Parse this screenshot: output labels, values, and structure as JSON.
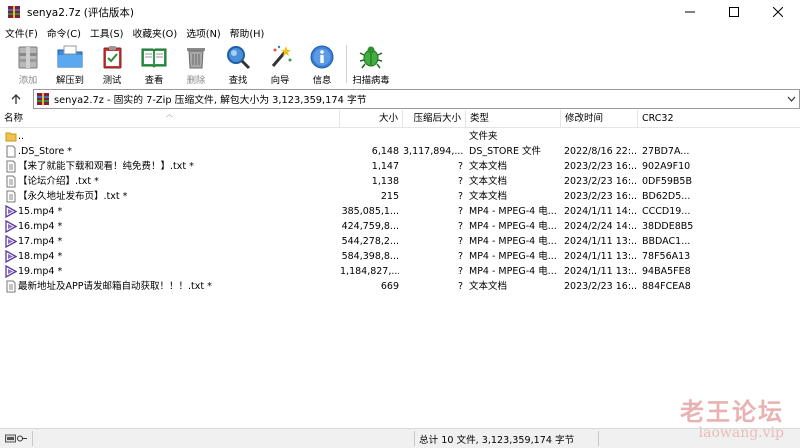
{
  "window": {
    "title": "senya2.7z (评估版本)"
  },
  "menu": [
    "文件(F)",
    "命令(C)",
    "工具(S)",
    "收藏夹(O)",
    "选项(N)",
    "帮助(H)"
  ],
  "toolbar": {
    "add": "添加",
    "extract": "解压到",
    "test": "测试",
    "view": "查看",
    "delete": "删除",
    "find": "查找",
    "wizard": "向导",
    "info": "信息",
    "scan": "扫描病毒"
  },
  "address": {
    "text": "senya2.7z - 固实的 7-Zip 压缩文件, 解包大小为 3,123,359,174 字节"
  },
  "columns": {
    "name": "名称",
    "size": "大小",
    "packed": "压缩后大小",
    "type": "类型",
    "modified": "修改时间",
    "crc": "CRC32"
  },
  "files": [
    {
      "icon": "folder-up-icon",
      "name": "..",
      "size": "",
      "packed": "",
      "type": "文件夹",
      "modified": "",
      "crc": ""
    },
    {
      "icon": "file-icon",
      "name": ".DS_Store *",
      "size": "6,148",
      "packed": "3,117,894,...",
      "type": "DS_STORE 文件",
      "modified": "2022/8/16 22:..",
      "crc": "27BD7A..."
    },
    {
      "icon": "text-file-icon",
      "name": "【来了就能下载和观看！纯免费！】.txt *",
      "size": "1,147",
      "packed": "?",
      "type": "文本文档",
      "modified": "2023/2/23 16:...",
      "crc": "902A9F10"
    },
    {
      "icon": "text-file-icon",
      "name": "【论坛介绍】.txt *",
      "size": "1,138",
      "packed": "?",
      "type": "文本文档",
      "modified": "2023/2/23 16:...",
      "crc": "0DF59B5B"
    },
    {
      "icon": "text-file-icon",
      "name": "【永久地址发布页】.txt *",
      "size": "215",
      "packed": "?",
      "type": "文本文档",
      "modified": "2023/2/23 16:...",
      "crc": "BD62D5..."
    },
    {
      "icon": "video-file-icon",
      "name": "15.mp4 *",
      "size": "385,085,1...",
      "packed": "?",
      "type": "MP4 - MPEG-4 电...",
      "modified": "2024/1/11 14:...",
      "crc": "CCCD19..."
    },
    {
      "icon": "video-file-icon",
      "name": "16.mp4 *",
      "size": "424,759,8...",
      "packed": "?",
      "type": "MP4 - MPEG-4 电...",
      "modified": "2024/2/24 14:...",
      "crc": "38DDE8B5"
    },
    {
      "icon": "video-file-icon",
      "name": "17.mp4 *",
      "size": "544,278,2...",
      "packed": "?",
      "type": "MP4 - MPEG-4 电...",
      "modified": "2024/1/11 13:...",
      "crc": "BBDAC1..."
    },
    {
      "icon": "video-file-icon",
      "name": "18.mp4 *",
      "size": "584,398,8...",
      "packed": "?",
      "type": "MP4 - MPEG-4 电...",
      "modified": "2024/1/11 13:...",
      "crc": "78F56A13"
    },
    {
      "icon": "video-file-icon",
      "name": "19.mp4 *",
      "size": "1,184,827,...",
      "packed": "?",
      "type": "MP4 - MPEG-4 电...",
      "modified": "2024/1/11 13:...",
      "crc": "94BA5FE8"
    },
    {
      "icon": "text-file-icon",
      "name": "最新地址及APP请发邮箱自动获取！！！.txt *",
      "size": "669",
      "packed": "?",
      "type": "文本文档",
      "modified": "2023/2/23 16:...",
      "crc": "884FCEA8"
    }
  ],
  "status": {
    "summary": "总计 10 文件, 3,123,359,174 字节"
  },
  "watermark": {
    "line1": "老王论坛",
    "line2": "laowang.vip"
  }
}
